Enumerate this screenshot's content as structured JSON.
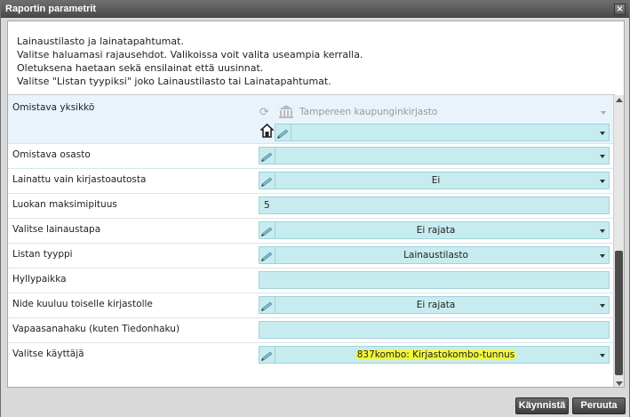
{
  "window": {
    "title": "Raportin parametrit",
    "close_glyph": "×"
  },
  "intro": [
    "Lainaustilasto ja lainatapahtumat.",
    "Valitse haluamasi rajausehdot. Valikoissa voit valita useampia kerralla.",
    "Oletuksena haetaan sekä ensilainat että uusinnat.",
    "Valitse \"Listan tyypiksi\" joko Lainaustilasto tai Lainatapahtumat."
  ],
  "fields": {
    "omistava_yksikko": {
      "label": "Omistava yksikkö",
      "library": "Tampereen kaupunginkirjasto",
      "value": ""
    },
    "omistava_osasto": {
      "label": "Omistava osasto",
      "value": ""
    },
    "kirjastoauto": {
      "label": "Lainattu vain kirjastoautosta",
      "value": "Ei"
    },
    "luokan_pituus": {
      "label": "Luokan maksimipituus",
      "value": "5"
    },
    "lainaustapa": {
      "label": "Valitse lainaustapa",
      "value": "Ei rajata"
    },
    "listan_tyyppi": {
      "label": "Listan tyyppi",
      "value": "Lainaustilasto"
    },
    "hyllypaikka": {
      "label": "Hyllypaikka",
      "value": ""
    },
    "toinen_kirjasto": {
      "label": "Nide kuuluu toiselle kirjastolle",
      "value": "Ei rajata"
    },
    "vapaasana": {
      "label": "Vapaasanahaku (kuten Tiedonhaku)",
      "value": ""
    },
    "kayttaja": {
      "label": "Valitse käyttäjä",
      "value": "837kombo: Kirjastokombo-tunnus"
    }
  },
  "buttons": {
    "start": "Käynnistä",
    "cancel": "Peruuta"
  },
  "colors": {
    "field_bg": "#c7ecef",
    "highlight": "#f2f83a",
    "titlebar": "#4a4a4a"
  }
}
